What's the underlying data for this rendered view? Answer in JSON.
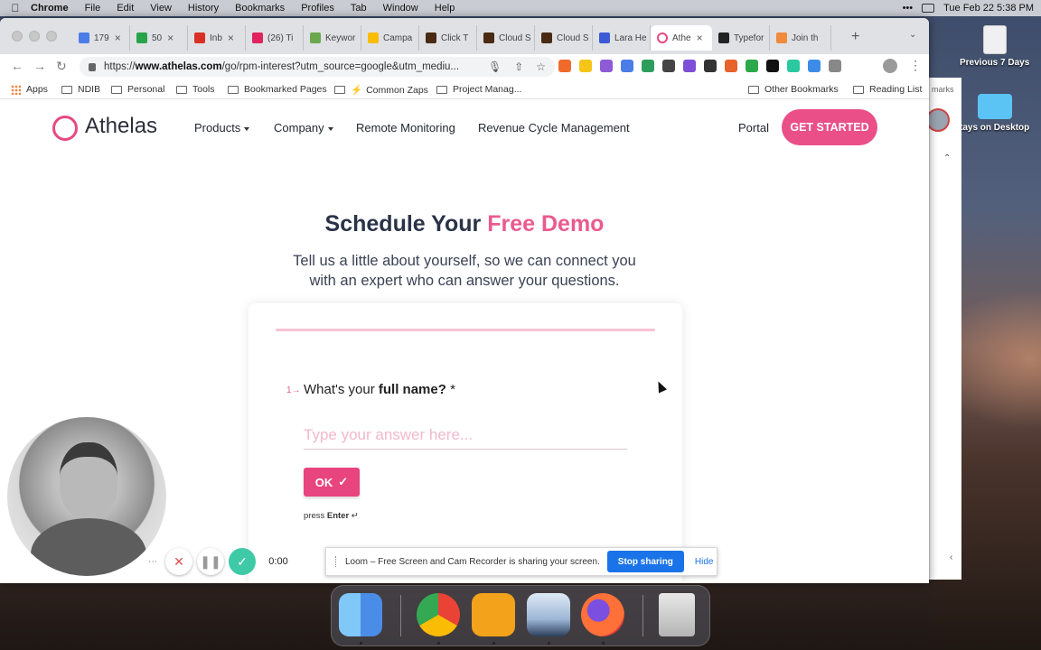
{
  "menubar": {
    "app": "Chrome",
    "items": [
      "File",
      "Edit",
      "View",
      "History",
      "Bookmarks",
      "Profiles",
      "Tab",
      "Window",
      "Help"
    ],
    "clock": "Tue Feb 22  5:38 PM"
  },
  "desktop": {
    "items": [
      {
        "label": "Previous 7 Days"
      },
      {
        "label": "tays on Desktop"
      }
    ],
    "side_partial": "marks"
  },
  "browser": {
    "tabs": [
      {
        "label": "179",
        "color": "#4a7de8"
      },
      {
        "label": "50",
        "color": "#27a34a"
      },
      {
        "label": "Inb",
        "color": "#d93025"
      },
      {
        "label": "(26) Ti",
        "color": "#e0245e"
      },
      {
        "label": "Keywor",
        "color": "#6aa84f"
      },
      {
        "label": "Campa",
        "color": "#fbbc05"
      },
      {
        "label": "Click T",
        "color": "#4a2a12"
      },
      {
        "label": "Cloud S",
        "color": "#4a2a12"
      },
      {
        "label": "Cloud S",
        "color": "#4a2a12"
      },
      {
        "label": "Lara He",
        "color": "#3b5bd6"
      },
      {
        "label": "Athe",
        "color": "#e64982",
        "active": true
      },
      {
        "label": "Typefor",
        "color": "#222222"
      },
      {
        "label": "Join th",
        "color": "#f08a3c"
      }
    ],
    "url_prefix": "https://",
    "url_host": "www.athelas.com",
    "url_rest": "/go/rpm-interest?utm_source=google&utm_mediu...",
    "bookmarks": [
      {
        "label": "Apps",
        "type": "grid"
      },
      {
        "label": "NDIB",
        "type": "folder"
      },
      {
        "label": "Personal",
        "type": "folder"
      },
      {
        "label": "Tools",
        "type": "folder"
      },
      {
        "label": "Bookmarked Pages",
        "type": "folder"
      },
      {
        "label": "Common Zaps",
        "type": "folder"
      },
      {
        "label": "Project Manag...",
        "type": "folder"
      }
    ],
    "bookmarks_right": [
      "Other Bookmarks",
      "Reading List"
    ]
  },
  "site": {
    "logo": "Athelas",
    "nav": [
      "Products",
      "Company",
      "Remote Monitoring",
      "Revenue Cycle Management"
    ],
    "portal": "Portal",
    "cta": "GET STARTED",
    "headline_dark": "Schedule Your ",
    "headline_pink": "Free Demo",
    "subline_1": "Tell us a little about yourself, so we can connect you",
    "subline_2": "with an expert who can answer your questions."
  },
  "form": {
    "number": "1→",
    "question_pre": "What's your ",
    "question_bold": "full name?",
    "question_post": " *",
    "placeholder": "Type your answer here...",
    "ok": "OK",
    "hint_pre": "press ",
    "hint_key": "Enter",
    "hint_post": " ↵"
  },
  "loom": {
    "timer": "0:00",
    "share_text": "Loom – Free Screen and Cam Recorder is sharing your screen.",
    "stop": "Stop sharing",
    "hide": "Hide"
  },
  "colors": {
    "brand_pink": "#ea4f88",
    "heading_navy": "#2a3347",
    "loom_blue": "#1a73e8",
    "loom_green": "#3ec9a7"
  },
  "icons": [
    "apple-icon",
    "lock-icon",
    "star-icon",
    "mic-icon",
    "share-icon",
    "check-icon",
    "close-icon",
    "pause-icon",
    "more-icon"
  ]
}
